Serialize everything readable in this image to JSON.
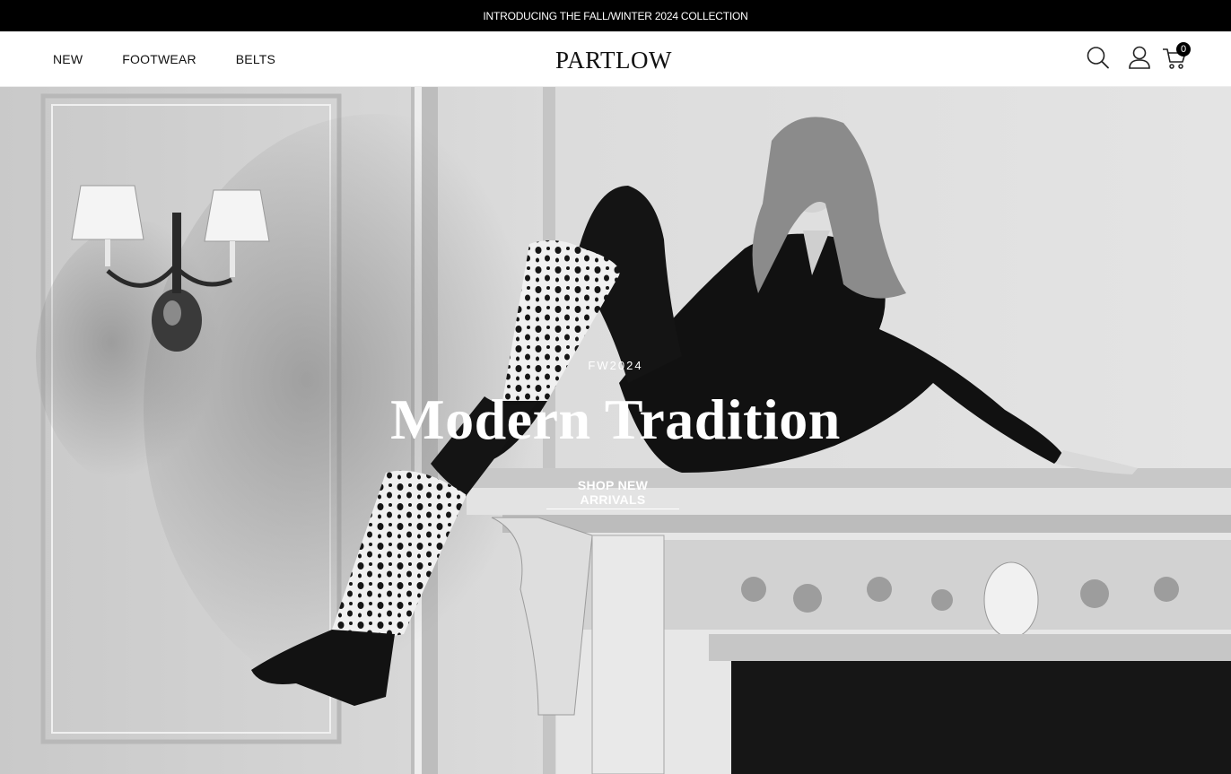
{
  "announcement": "INTRODUCING THE FALL/WINTER 2024 COLLECTION",
  "nav": {
    "links": [
      "NEW",
      "FOOTWEAR",
      "BELTS"
    ],
    "logo": "PARTLOW",
    "icons": [
      "search-icon",
      "account-icon",
      "cart-icon"
    ],
    "cart_count": "0"
  },
  "hero": {
    "eyebrow": "FW2024",
    "title": "Modern Tradition",
    "cta": "SHOP NEW ARRIVALS"
  },
  "colors": {
    "announcement_bg": "#000000",
    "text_light": "#ffffff",
    "text_dark": "#111111"
  }
}
